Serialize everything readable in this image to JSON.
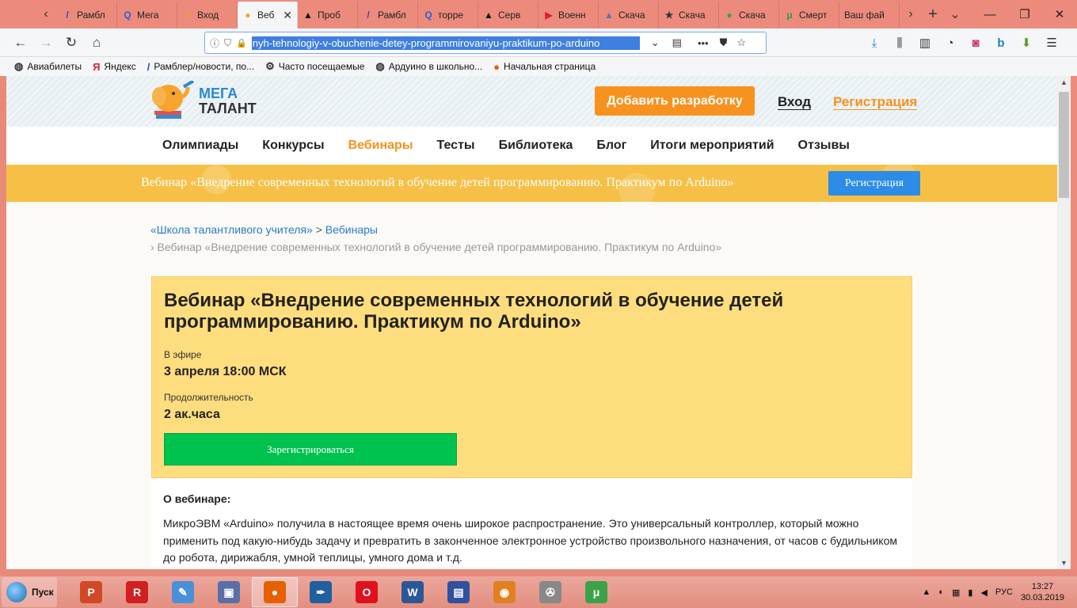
{
  "browser": {
    "tabs": [
      {
        "label": "Рамбл",
        "color": "#3344cc",
        "glyph": "/"
      },
      {
        "label": "Мега",
        "color": "#2a5fd6",
        "glyph": "Q"
      },
      {
        "label": "Вход",
        "color": "#e8a030",
        "glyph": "♦"
      },
      {
        "label": "Веб",
        "color": "#f5a23b",
        "glyph": "●",
        "active": true
      },
      {
        "label": "Проб",
        "color": "#111111",
        "glyph": "▲"
      },
      {
        "label": "Рамбл",
        "color": "#3344cc",
        "glyph": "/"
      },
      {
        "label": "торре",
        "color": "#2a5fd6",
        "glyph": "Q"
      },
      {
        "label": "Серв",
        "color": "#111111",
        "glyph": "▲"
      },
      {
        "label": "Военн",
        "color": "#d9232e",
        "glyph": "▶"
      },
      {
        "label": "Скача",
        "color": "#5577aa",
        "glyph": "▲"
      },
      {
        "label": "Скача",
        "color": "#333333",
        "glyph": "★"
      },
      {
        "label": "Скача",
        "color": "#3aa04a",
        "glyph": "●"
      },
      {
        "label": "Смерт",
        "color": "#2c9b4b",
        "glyph": "μ"
      },
      {
        "label": "Ваш фай",
        "color": "",
        "glyph": ""
      }
    ],
    "url": "nyh-tehnologiy-v-obuchenie-detey-programmirovaniyu-praktikum-po-arduino",
    "bookmarks": [
      {
        "label": "Авиабилеты",
        "icon": "globe-icon",
        "glyph": "◍"
      },
      {
        "label": "Яндекс",
        "icon": "yandex-icon",
        "glyph": "Я"
      },
      {
        "label": "Рамблер/новости, по...",
        "icon": "rambler-icon",
        "glyph": "/"
      },
      {
        "label": "Часто посещаемые",
        "icon": "gear-icon",
        "glyph": "⚙"
      },
      {
        "label": "Ардуино в  школьно...",
        "icon": "globe-icon",
        "glyph": "◍"
      },
      {
        "label": "Начальная страница",
        "icon": "firefox-icon",
        "glyph": "●"
      }
    ]
  },
  "site": {
    "logo_line1": "МЕГА",
    "logo_line2": "ТАЛАНТ",
    "add_button": "Добавить разработку",
    "login": "Вход",
    "register": "Регистрация",
    "nav": [
      "Олимпиады",
      "Конкурсы",
      "Вебинары",
      "Тесты",
      "Библиотека",
      "Блог",
      "Итоги мероприятий",
      "Отзывы"
    ],
    "nav_active": "Вебинары",
    "banner_text": "Вебинар «Внедрение современных технологий в обучение детей программированию. Практикум по Arduino»",
    "banner_button": "Регистрация",
    "breadcrumb": {
      "item1": "«Школа талантливого учителя»",
      "sep": " > ",
      "item2": "Вебинары",
      "current": "› Вебинар «Внедрение современных технологий в обучение детей программированию. Практикум по Arduino»"
    },
    "card": {
      "title": "Вебинар «Внедрение современных технологий в обучение детей программированию. Практикум по Arduino»",
      "live_label": "В эфире",
      "live_value": "3 апреля 18:00 МСК",
      "duration_label": "Продолжительность",
      "duration_value": "2 ак.часа",
      "register_button": "Зарегистрироваться"
    },
    "about": {
      "heading": "О вебинаре:",
      "text": "МикроЭВМ «Arduino» получила в настоящее время очень широкое распространение. Это универсальный контроллер, который можно применить под какую-нибудь задачу и превратить в законченное электронное устройство произвольного назначения, от часов с будильником до робота, дирижабля, умной теплицы, умного дома и т.д."
    }
  },
  "taskbar": {
    "start": "Пуск",
    "apps": [
      {
        "name": "powerpoint-icon",
        "color": "#d24726",
        "glyph": "P"
      },
      {
        "name": "foxit-reader-icon",
        "color": "#d02020",
        "glyph": "R"
      },
      {
        "name": "paint-icon",
        "color": "#4a90d9",
        "glyph": "✎"
      },
      {
        "name": "photo-viewer-icon",
        "color": "#5a6ea8",
        "glyph": "▣"
      },
      {
        "name": "firefox-icon",
        "color": "#e66000",
        "glyph": "●",
        "active": true
      },
      {
        "name": "pen-tool-icon",
        "color": "#2060a0",
        "glyph": "✒"
      },
      {
        "name": "opera-icon",
        "color": "#e0101f",
        "glyph": "O"
      },
      {
        "name": "word-icon",
        "color": "#2b5797",
        "glyph": "W"
      },
      {
        "name": "save-disk-icon",
        "color": "#3050a0",
        "glyph": "▤"
      },
      {
        "name": "eye-app-icon",
        "color": "#e08020",
        "glyph": "◉"
      },
      {
        "name": "film-reel-icon",
        "color": "#888888",
        "glyph": "✇"
      },
      {
        "name": "utorrent-icon",
        "color": "#3aa34a",
        "glyph": "μ"
      }
    ],
    "lang": "РУС",
    "time": "13:27",
    "date": "30.03.2019"
  }
}
